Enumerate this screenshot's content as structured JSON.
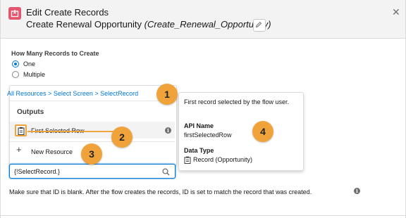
{
  "modal": {
    "title": "Edit Create Records",
    "subtitle_label": "Create Renewal Opportunity",
    "subtitle_api": "(Create_Renewal_Opportunity)",
    "close_icon": "close-icon",
    "edit_icon": "pencil-icon",
    "header_icon": "create-records-icon",
    "header_icon_color": "#e3566d"
  },
  "record_count": {
    "label": "How Many Records to Create",
    "options": [
      {
        "label": "One",
        "selected": true
      },
      {
        "label": "Multiple",
        "selected": false
      }
    ]
  },
  "resource_picker": {
    "breadcrumb": [
      "All Resources",
      "Select Screen",
      "SelectRecord"
    ],
    "breadcrumb_separator": ">",
    "section_heading": "Outputs",
    "items": [
      {
        "label": "First Selected Row",
        "icon": "record-icon",
        "highlighted": true
      }
    ],
    "new_resource_label": "New Resource",
    "input_value": "{!SelectRecord.}",
    "search_icon": "search-icon"
  },
  "tooltip": {
    "description": "First record selected by the flow user.",
    "api_name_label": "API Name",
    "api_name_value": "firstSelectedRow",
    "data_type_label": "Data Type",
    "data_type_value": "Record (Opportunity)"
  },
  "help_text": "Make sure that ID is blank. After the flow creates the records, ID is set to match the record that was created.",
  "callouts": [
    "1",
    "2",
    "3",
    "4"
  ],
  "colors": {
    "accent": "#0176d3",
    "callout": "#f0a23b",
    "header_bg": "#f3f3f3"
  }
}
